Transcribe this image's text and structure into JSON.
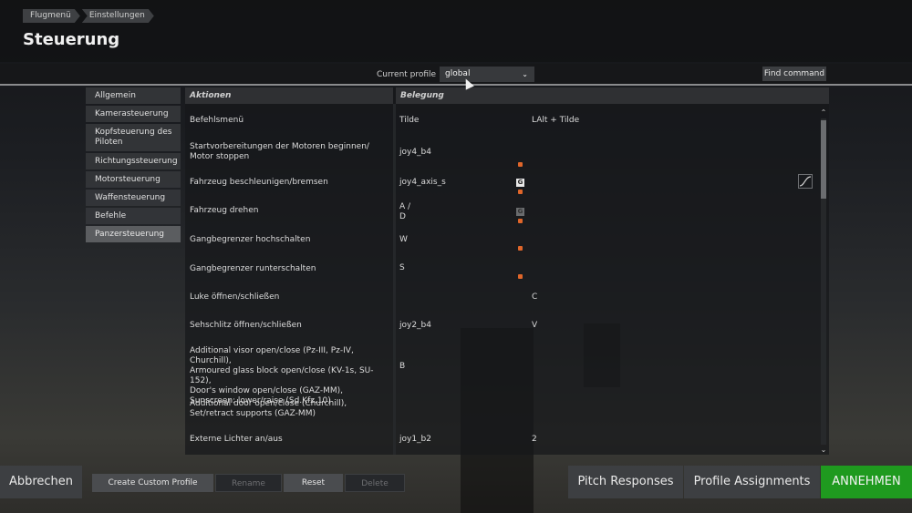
{
  "breadcrumb": [
    "Flugmenü",
    "Einstellungen"
  ],
  "page_title": "Steuerung",
  "profile": {
    "label": "Current profile",
    "selected": "global",
    "find_command_label": "Find command"
  },
  "sidebar": {
    "items": [
      {
        "label": "Allgemein",
        "active": false
      },
      {
        "label": "Kamerasteuerung",
        "active": false
      },
      {
        "label": "Kopfsteuerung des Piloten",
        "active": false
      },
      {
        "label": "Richtungssteuerung",
        "active": false
      },
      {
        "label": "Motorsteuerung",
        "active": false
      },
      {
        "label": "Waffensteuerung",
        "active": false
      },
      {
        "label": "Befehle",
        "active": false
      },
      {
        "label": "Panzersteuerung",
        "active": true
      }
    ]
  },
  "table": {
    "headers": {
      "actions": "Aktionen",
      "binding": "Belegung"
    },
    "rows": [
      {
        "action": "Befehlsmenü",
        "binding1": "Tilde",
        "binding2": "LAlt + Tilde"
      },
      {
        "action": "Startvorbereitungen der Motoren beginnen/ Motor stoppen",
        "binding1": "joy4_b4",
        "binding2": ""
      },
      {
        "action": "Fahrzeug beschleunigen/bremsen",
        "binding1": "joy4_axis_s",
        "binding2": ""
      },
      {
        "action": "Fahrzeug drehen",
        "binding1": "A /\nD",
        "binding2": ""
      },
      {
        "action": "Gangbegrenzer hochschalten",
        "binding1": "W",
        "binding2": ""
      },
      {
        "action": "Gangbegrenzer runterschalten",
        "binding1": "S",
        "binding2": ""
      },
      {
        "action": "Luke öffnen/schließen",
        "binding1": "",
        "binding2": "C"
      },
      {
        "action": "Sehschlitz öffnen/schließen",
        "binding1": "joy2_b4",
        "binding2": "V"
      },
      {
        "action": "Additional visor open/close (Pz-III, Pz-IV, Churchill),\nArmoured glass block open/close (KV-1s, SU-152),\nDoor's window open/close (GAZ-MM),\nSunscreen: lower/raise (Sd.Kfz.10)",
        "binding1": "B",
        "binding2": ""
      },
      {
        "action": "Additional door open/close (Churchill),\nSet/retract supports (GAZ-MM)",
        "binding1": "",
        "binding2": ""
      },
      {
        "action": "Externe Lichter an/aus",
        "binding1": "joy1_b2",
        "binding2": "2"
      }
    ],
    "gamepad_glyph": "G"
  },
  "buttons": {
    "cancel": "Abbrechen",
    "create_profile": "Create Custom Profile",
    "rename": "Rename",
    "reset": "Reset",
    "delete": "Delete",
    "pitch_responses": "Pitch Responses",
    "profile_assignments": "Profile Assignments",
    "accept": "ANNEHMEN"
  },
  "colors": {
    "accent_green": "#1f9a1f",
    "marker_orange": "#e0662a"
  }
}
